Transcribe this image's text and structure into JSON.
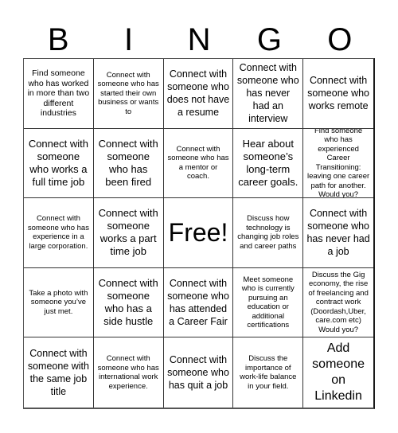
{
  "header": {
    "letters": [
      "B",
      "I",
      "N",
      "G",
      "O"
    ]
  },
  "board": {
    "cells": [
      "Find someone who has worked in more than two different industries",
      "Connect with someone who has started their own business or wants to",
      "Connect with someone who does not have a resume",
      "Connect with someone who has never had an interview",
      "Connect with someone who works remote",
      "Connect with someone who works a full time job",
      "Connect with someone who has been fired",
      "Connect with someone who has a mentor or coach.",
      "Hear about someone’s long-term career goals.",
      "Find someone who has experienced Career Transitioning: leaving one career path for another. Would you?",
      "Connect with someone who has experience in a large corporation.",
      "Connect with someone works a part time job",
      "Free!",
      "Discuss how technology is changing job roles and career paths",
      "Connect with someone who has never had a job",
      "Take a photo with someone you’ve just met.",
      "Connect with someone who has a side hustle",
      "Connect with someone who has attended a Career Fair",
      "Meet someone who is currently pursuing an education or additional certifications",
      "Discuss the Gig economy, the rise of freelancing and contract work (Doordash,Uber, care.com etc) Would you?",
      "Connect with someone with the same job title",
      "Connect with someone who has international work experience.",
      "Connect with someone who has quit a job",
      "Discuss the importance of work-life balance in your field.",
      "Add someone on Linkedin"
    ]
  }
}
